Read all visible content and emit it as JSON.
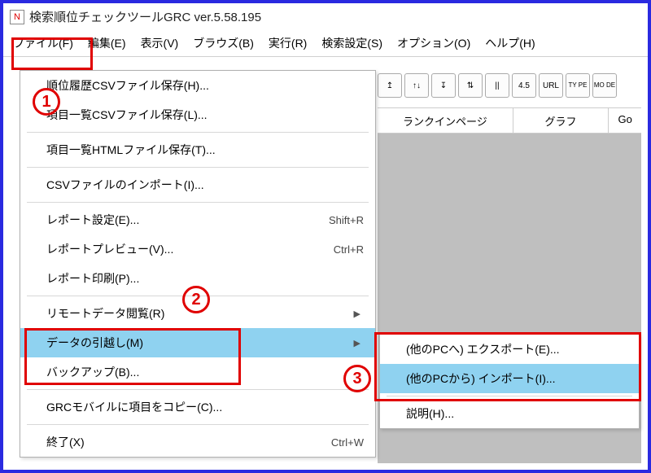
{
  "app": {
    "icon_glyph": "N",
    "title": "検索順位チェックツールGRC  ver.5.58.195"
  },
  "menubar": {
    "items": [
      {
        "label": "ファイル(F)"
      },
      {
        "label": "編集(E)"
      },
      {
        "label": "表示(V)"
      },
      {
        "label": "ブラウズ(B)"
      },
      {
        "label": "実行(R)"
      },
      {
        "label": "検索設定(S)"
      },
      {
        "label": "オプション(O)"
      },
      {
        "label": "ヘルプ(H)"
      }
    ]
  },
  "toolbar": {
    "buttons": [
      {
        "label": "↥"
      },
      {
        "label": "↑↓"
      },
      {
        "label": "↧"
      },
      {
        "label": "⇅"
      },
      {
        "label": "||"
      },
      {
        "label": "4.5"
      },
      {
        "label": "URL"
      },
      {
        "label": "TY\nPE"
      },
      {
        "label": "MO\nDE"
      }
    ]
  },
  "columns": {
    "c1": "ランクインページ",
    "c2": "グラフ",
    "c3": "Go"
  },
  "file_menu": {
    "items": [
      {
        "label": "順位履歴CSVファイル保存(H)...",
        "shortcut": "",
        "arrow": false
      },
      {
        "label": "項目一覧CSVファイル保存(L)...",
        "shortcut": "",
        "arrow": false
      },
      {
        "sep": true
      },
      {
        "label": "項目一覧HTMLファイル保存(T)...",
        "shortcut": "",
        "arrow": false
      },
      {
        "sep": true
      },
      {
        "label": "CSVファイルのインポート(I)...",
        "shortcut": "",
        "arrow": false
      },
      {
        "sep": true
      },
      {
        "label": "レポート設定(E)...",
        "shortcut": "Shift+R",
        "arrow": false
      },
      {
        "label": "レポートプレビュー(V)...",
        "shortcut": "Ctrl+R",
        "arrow": false
      },
      {
        "label": "レポート印刷(P)...",
        "shortcut": "",
        "arrow": false
      },
      {
        "sep": true
      },
      {
        "label": "リモートデータ閲覧(R)",
        "shortcut": "",
        "arrow": true
      },
      {
        "label": "データの引越し(M)",
        "shortcut": "",
        "arrow": true,
        "highlight": true
      },
      {
        "label": "バックアップ(B)...",
        "shortcut": "",
        "arrow": false
      },
      {
        "sep": true
      },
      {
        "label": "GRCモバイルに項目をコピー(C)...",
        "shortcut": "",
        "arrow": false
      },
      {
        "sep": true
      },
      {
        "label": "終了(X)",
        "shortcut": "Ctrl+W",
        "arrow": false
      }
    ]
  },
  "submenu": {
    "items": [
      {
        "label": "(他のPCへ) エクスポート(E)...",
        "highlight": false
      },
      {
        "label": "(他のPCから) インポート(I)...",
        "highlight": true
      },
      {
        "sep": true
      },
      {
        "label": "説明(H)...",
        "highlight": false
      }
    ]
  },
  "annotations": {
    "n1": "1",
    "n2": "2",
    "n3": "3"
  }
}
